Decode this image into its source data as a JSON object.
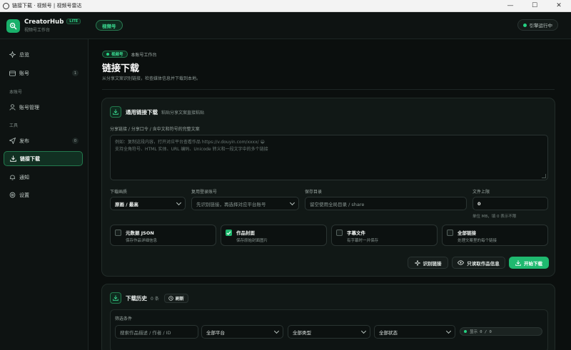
{
  "window": {
    "title": "链接下载 · 视频号 | 视频号雷达"
  },
  "brand": {
    "name": "CreatorHub",
    "badge": "LITE",
    "subtitle": "视频号工作台"
  },
  "topbar": {
    "platform_pill": "视频号",
    "engine_status": "引擎运行中"
  },
  "sidebar": {
    "items": [
      {
        "label": "总览",
        "icon": "sparkle-icon"
      },
      {
        "label": "账号",
        "icon": "id-card-icon",
        "count": "1"
      },
      {
        "label": "账号管理",
        "icon": "user-icon"
      },
      {
        "label": "发布",
        "icon": "send-icon",
        "count": "0"
      },
      {
        "label": "链接下载",
        "icon": "download-icon"
      },
      {
        "label": "通知",
        "icon": "bell-icon"
      },
      {
        "label": "设置",
        "icon": "gear-icon"
      }
    ],
    "sections": {
      "account": "本账号",
      "tools": "工具"
    }
  },
  "page": {
    "crumb_pill": "视频号",
    "crumb_text": "本账号工作台",
    "title": "链接下载",
    "description": "从分享文案识别链接，检查媒体信息并下载到本地。"
  },
  "download_card": {
    "title": "通用链接下载",
    "subtitle": "粘贴分享文案直接粘贴",
    "share_label": "分享链接 / 分享口令 / 含中文和符号的完整文案",
    "share_placeholder_line1": "例如：复制这段内容，打开对应平台查看作品 https://v.douyin.com/xxxx/ 😀",
    "share_placeholder_line2": "支持全角符号、HTML 实体、URL 编码、Unicode 转义和一段文字中的多个链接",
    "quality_label": "下载画质",
    "quality_value": "原画 / 最高",
    "reuse_label": "复用登录账号",
    "reuse_placeholder": "先识别链接，再选择对应平台账号",
    "dir_label": "保存目录",
    "dir_placeholder": "留空使用全局目录 / share",
    "limit_label": "文件上限",
    "limit_value": "0",
    "limit_hint": "单位 MB，填 0 表示不限",
    "options": [
      {
        "title": "元数据 JSON",
        "desc": "保存作品详细信息",
        "checked": false
      },
      {
        "title": "作品封面",
        "desc": "保存原始封面图片",
        "checked": true
      },
      {
        "title": "字幕文件",
        "desc": "有字幕时一并保存",
        "checked": false
      },
      {
        "title": "全部链接",
        "desc": "处理文案里的每个链接",
        "checked": false
      }
    ],
    "buttons": {
      "identify": "识别链接",
      "read_info": "只读取作品信息",
      "start": "开始下载"
    }
  },
  "history_card": {
    "title": "下载历史",
    "count": "0 条",
    "refresh": "刷新",
    "filter_label": "筛选条件",
    "search_placeholder": "搜索作品描述 / 作者 / ID",
    "platform_select": "全部平台",
    "type_select": "全部类型",
    "status_select": "全部状态",
    "show_count": "显示 0 / 0"
  },
  "colors": {
    "accent": "#1fb96f",
    "background": "#0b0f0e",
    "panel": "#111816"
  }
}
